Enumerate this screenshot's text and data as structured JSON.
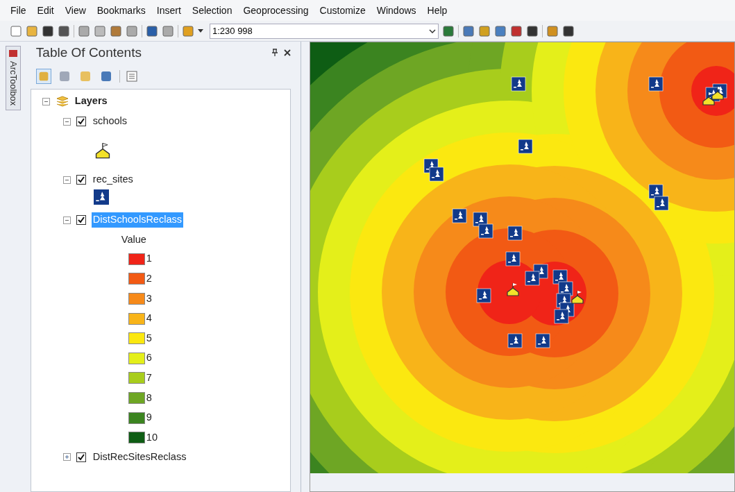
{
  "menu": [
    "File",
    "Edit",
    "View",
    "Bookmarks",
    "Insert",
    "Selection",
    "Geoprocessing",
    "Customize",
    "Windows",
    "Help"
  ],
  "toolbar": {
    "scale": "1:230 998"
  },
  "side_tab": {
    "label": "ArcToolbox"
  },
  "toc": {
    "title": "Table Of Contents",
    "root": {
      "label": "Layers",
      "expanded": true,
      "children": [
        {
          "kind": "point",
          "label": "schools",
          "checked": true,
          "expanded": true,
          "selected": false,
          "symbol": {
            "kind": "school"
          }
        },
        {
          "kind": "point",
          "label": "rec_sites",
          "checked": true,
          "expanded": true,
          "selected": false,
          "symbol": {
            "kind": "recreation"
          }
        },
        {
          "kind": "raster",
          "label": "DistSchoolsReclass",
          "checked": true,
          "expanded": true,
          "selected": true,
          "legend_heading": "Value",
          "classes": [
            {
              "label": "1",
              "color": "#f02418"
            },
            {
              "label": "2",
              "color": "#f25a14"
            },
            {
              "label": "3",
              "color": "#f68a1a"
            },
            {
              "label": "4",
              "color": "#f8b419"
            },
            {
              "label": "5",
              "color": "#fbe810"
            },
            {
              "label": "6",
              "color": "#e4ef1a"
            },
            {
              "label": "7",
              "color": "#a8cd1c"
            },
            {
              "label": "8",
              "color": "#6ea624"
            },
            {
              "label": "9",
              "color": "#3b8420"
            },
            {
              "label": "10",
              "color": "#0e5d14"
            }
          ]
        },
        {
          "label": "DistRecSitesReclass",
          "checked": true,
          "expanded": false,
          "selected": false
        }
      ]
    }
  }
}
